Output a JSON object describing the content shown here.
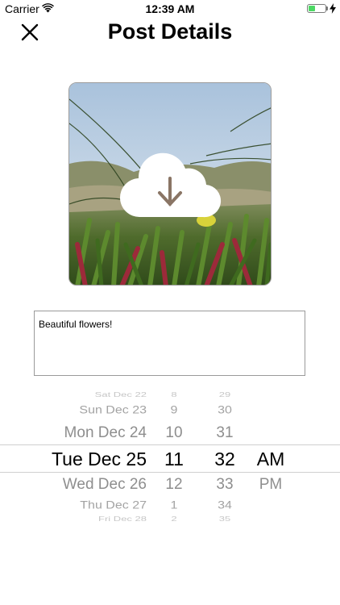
{
  "status_bar": {
    "carrier": "Carrier",
    "time": "12:39 AM",
    "battery_color": "#4cd964"
  },
  "header": {
    "title": "Post Details",
    "close_icon": "close-icon"
  },
  "post": {
    "image_overlay_icon": "cloud-download-icon",
    "caption": "Beautiful flowers!"
  },
  "date_picker": {
    "rows": [
      {
        "date": "Sat Dec 22",
        "hour": "8",
        "minute": "29",
        "ampm": ""
      },
      {
        "date": "Sun Dec 23",
        "hour": "9",
        "minute": "30",
        "ampm": ""
      },
      {
        "date": "Mon Dec 24",
        "hour": "10",
        "minute": "31",
        "ampm": ""
      },
      {
        "date": "Tue Dec 25",
        "hour": "11",
        "minute": "32",
        "ampm": "AM"
      },
      {
        "date": "Wed Dec 26",
        "hour": "12",
        "minute": "33",
        "ampm": "PM"
      },
      {
        "date": "Thu Dec 27",
        "hour": "1",
        "minute": "34",
        "ampm": ""
      },
      {
        "date": "Fri Dec 28",
        "hour": "2",
        "minute": "35",
        "ampm": ""
      }
    ],
    "selected_index": 3
  }
}
